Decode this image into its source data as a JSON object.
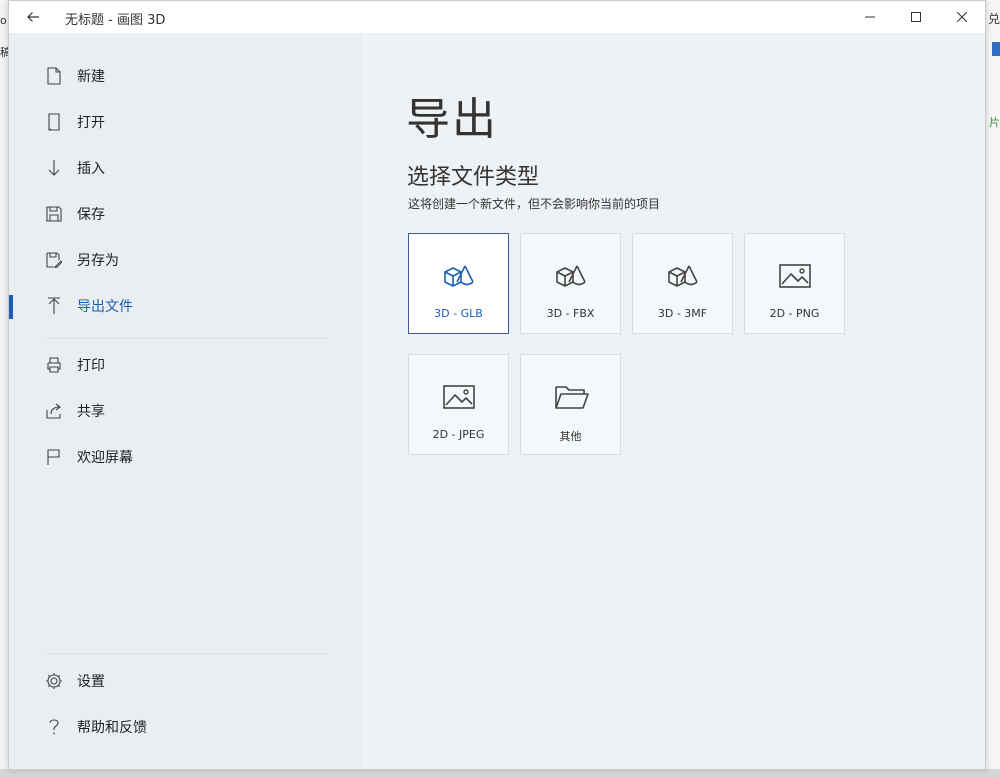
{
  "window": {
    "title": "无标题 - 画图 3D"
  },
  "background": {
    "left_fragment_1": "o",
    "left_fragment_2": "稿",
    "right_fragment_1": "兑",
    "right_fragment_2": "片"
  },
  "sidebar": {
    "items": [
      {
        "label": "新建",
        "icon": "new-file-icon"
      },
      {
        "label": "打开",
        "icon": "open-icon"
      },
      {
        "label": "插入",
        "icon": "insert-icon"
      },
      {
        "label": "保存",
        "icon": "save-icon"
      },
      {
        "label": "另存为",
        "icon": "save-as-icon"
      },
      {
        "label": "导出文件",
        "icon": "export-icon",
        "active": true
      },
      {
        "label": "打印",
        "icon": "print-icon"
      },
      {
        "label": "共享",
        "icon": "share-icon"
      },
      {
        "label": "欢迎屏幕",
        "icon": "flag-icon"
      }
    ],
    "bottom_items": [
      {
        "label": "设置",
        "icon": "gear-icon"
      },
      {
        "label": "帮助和反馈",
        "icon": "help-icon"
      }
    ]
  },
  "main": {
    "title": "导出",
    "section_title": "选择文件类型",
    "section_subtitle": "这将创建一个新文件，但不会影响你当前的项目",
    "tiles": [
      {
        "label": "3D - GLB",
        "icon": "3d-shapes-icon",
        "selected": true
      },
      {
        "label": "3D - FBX",
        "icon": "3d-shapes-icon"
      },
      {
        "label": "3D - 3MF",
        "icon": "3d-shapes-icon"
      },
      {
        "label": "2D - PNG",
        "icon": "image-icon"
      },
      {
        "label": "2D - JPEG",
        "icon": "image-icon"
      },
      {
        "label": "其他",
        "icon": "folder-icon"
      }
    ]
  },
  "colors": {
    "accent": "#1a5fb4",
    "sidebar_bg": "#e9eef3",
    "main_bg": "#eef2f5",
    "selected_border": "#3d5b9c"
  }
}
